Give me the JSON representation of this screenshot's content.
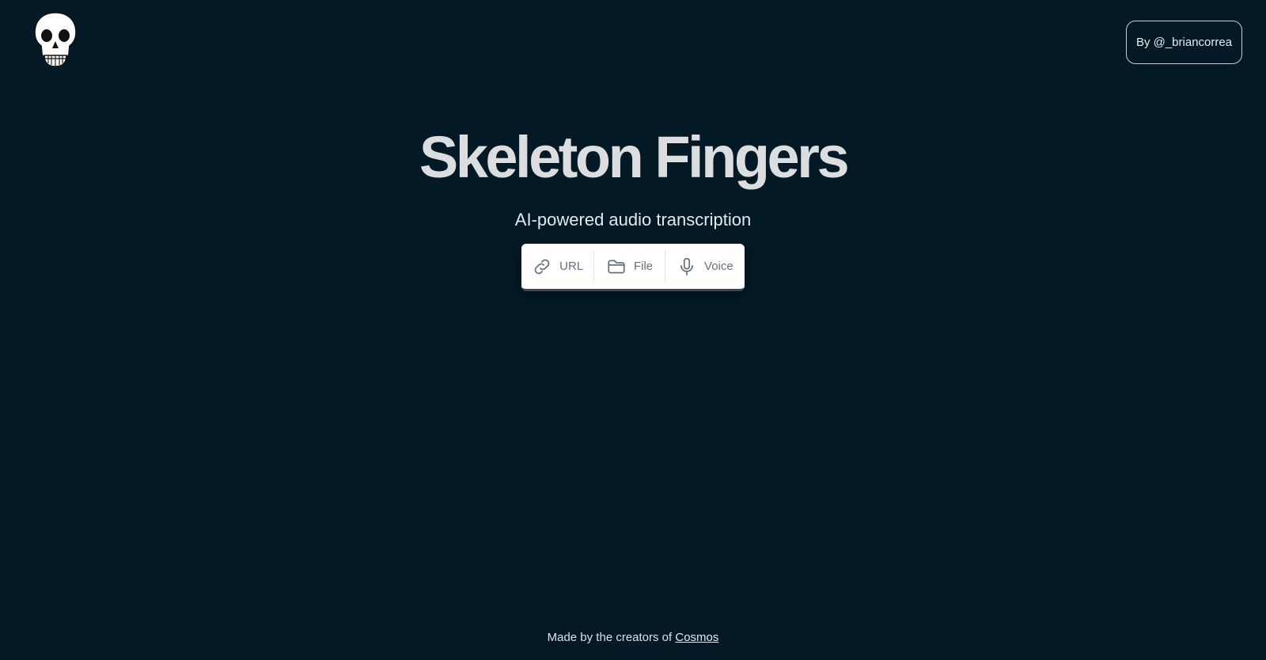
{
  "header": {
    "logo_icon": "skull-icon",
    "author_label": "By @_briancorrea"
  },
  "hero": {
    "title": "Skeleton Fingers",
    "subtitle": "AI-powered audio transcription"
  },
  "modes": [
    {
      "icon": "link-icon",
      "label": "URL"
    },
    {
      "icon": "folder-icon",
      "label": "File"
    },
    {
      "icon": "microphone-icon",
      "label": "Voice"
    }
  ],
  "footer": {
    "text": "Made by the creators of ",
    "link_label": "Cosmos"
  },
  "colors": {
    "background": "#031925",
    "text": "#dcdddf",
    "mode_text": "#66707d"
  }
}
